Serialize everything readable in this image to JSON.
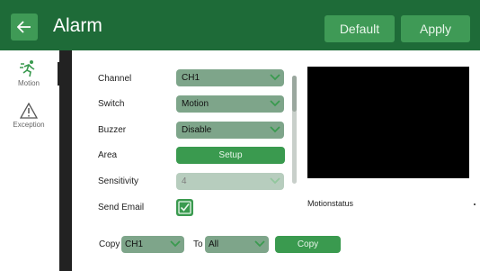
{
  "header": {
    "back_icon": "arrow-left-icon",
    "title": "Alarm",
    "default_label": "Default",
    "apply_label": "Apply"
  },
  "sidebar": {
    "items": [
      {
        "label": "Motion",
        "icon": "running-person-icon",
        "active": true
      },
      {
        "label": "Exception",
        "icon": "warning-triangle-icon",
        "active": false
      }
    ]
  },
  "form": {
    "channel": {
      "label": "Channel",
      "value": "CH1"
    },
    "switch": {
      "label": "Switch",
      "value": "Motion"
    },
    "buzzer": {
      "label": "Buzzer",
      "value": "Disable"
    },
    "area": {
      "label": "Area",
      "button": "Setup"
    },
    "sensitivity": {
      "label": "Sensitivity",
      "value": "4"
    },
    "send_email": {
      "label": "Send Email",
      "checked": true
    }
  },
  "preview": {
    "motion_status_label": "Motionstatus"
  },
  "copy": {
    "label": "Copy",
    "from_value": "CH1",
    "to_label": "To",
    "to_value": "All",
    "button": "Copy"
  },
  "colors": {
    "header_bg": "#1e6b38",
    "button_green": "#3a9a4f",
    "select_bg": "#7ea58a"
  }
}
